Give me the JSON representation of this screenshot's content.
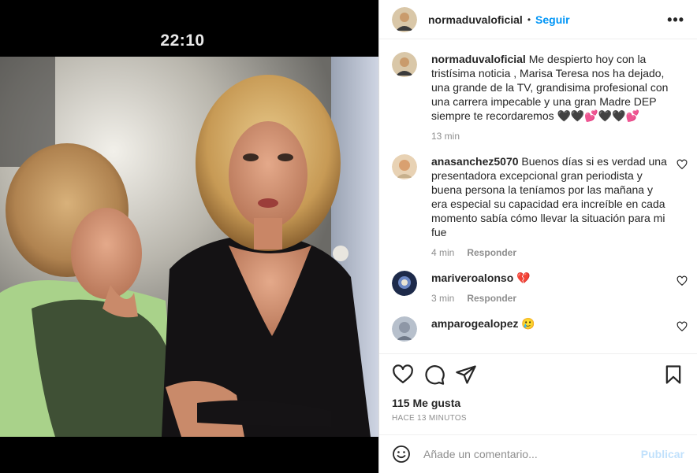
{
  "media": {
    "clock": "22:10"
  },
  "header": {
    "username": "normaduvaloficial",
    "separator": "•",
    "follow_label": "Seguir",
    "more_label": "•••"
  },
  "caption": {
    "username": "normaduvaloficial",
    "text": "Me despierto hoy con la tristísima noticia , Marisa Teresa nos ha dejado, una grande de la TV, grandisima profesional con una carrera impecable y una gran Madre DEP siempre te recordaremos 🖤🖤💕🖤🖤💕",
    "time": "13 min"
  },
  "comments": [
    {
      "username": "anasanchez5070",
      "text": "Buenos días si es verdad una presentadora excepcional gran periodista y buena persona la teníamos por las mañana y era especial su capacidad era increíble en cada momento sabía cómo llevar la situación para mi fue",
      "time": "4 min",
      "reply_label": "Responder"
    },
    {
      "username": "mariveroalonso",
      "text": "💔",
      "time": "3 min",
      "reply_label": "Responder"
    },
    {
      "username": "amparogealopez",
      "text": "🥲",
      "time": "",
      "reply_label": ""
    }
  ],
  "actions": {
    "icons": [
      "heart-icon",
      "comment-icon",
      "share-icon",
      "bookmark-icon"
    ],
    "likes": "115 Me gusta",
    "ago": "HACE 13 MINUTOS"
  },
  "compose": {
    "placeholder": "Añade un comentario...",
    "publish_label": "Publicar"
  },
  "colors": {
    "accent": "#0095f6",
    "publish_disabled": "#c1e1fc",
    "muted": "#8e8e8e",
    "text": "#262626"
  }
}
